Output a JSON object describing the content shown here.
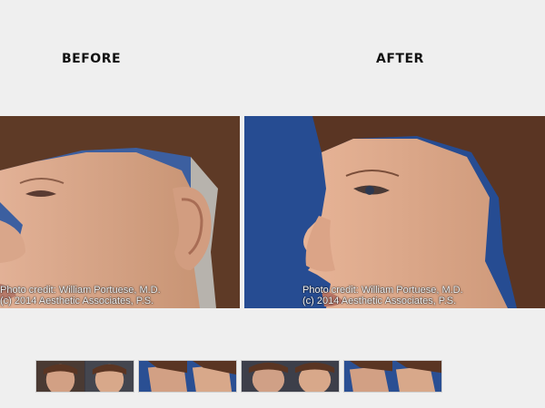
{
  "labels": {
    "before": "BEFORE",
    "after": "AFTER"
  },
  "photos": {
    "before": {
      "credit_line1": "Photo credit: William Portuese, M.D.",
      "credit_line2": "(c) 2014 Aesthetic Associates, P.S."
    },
    "after": {
      "credit_line1": "Photo credit: William Portuese, M.D.",
      "credit_line2": "(c) 2014 Aesthetic Associates, P.S."
    }
  },
  "thumbnails": [
    {
      "name": "front-view"
    },
    {
      "name": "profile-view"
    },
    {
      "name": "three-quarter-view"
    },
    {
      "name": "oblique-view"
    }
  ],
  "colors": {
    "background": "#efefef",
    "photo_backdrop": "#2a4f93",
    "skin": "#d8a88a",
    "hair": "#5a3523"
  }
}
